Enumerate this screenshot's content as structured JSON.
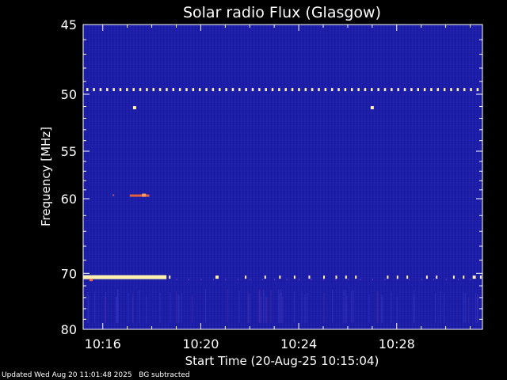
{
  "chart_data": {
    "type": "heatmap",
    "title": "Solar radio Flux (Glasgow)",
    "xlabel": "Start Time (20-Aug-25 10:15:04)",
    "ylabel": "Frequency [MHz]",
    "x_range_minutes": [
      15.2,
      31.5
    ],
    "x_ticks": [
      {
        "minute": 16,
        "label": "10:16"
      },
      {
        "minute": 20,
        "label": "10:20"
      },
      {
        "minute": 24,
        "label": "10:24"
      },
      {
        "minute": 28,
        "label": "10:28"
      }
    ],
    "y_range_mhz": [
      45,
      80
    ],
    "y_ticks": [
      45,
      50,
      55,
      60,
      70,
      80
    ],
    "background_color": "#1e1ea8",
    "hot_color": "#fff2b0",
    "features": [
      {
        "name": "interference band",
        "freq_mhz": 49.6,
        "pattern": "dotted"
      },
      {
        "name": "burst dots",
        "freq_mhz": 51.1,
        "times_min": [
          17.3,
          27.0
        ]
      },
      {
        "name": "weak emission",
        "freq_mhz": 59.6,
        "time_range_min": [
          16.4,
          17.9
        ]
      },
      {
        "name": "strong emission",
        "freq_mhz": 70.6,
        "time_range_min": [
          15.2,
          18.6
        ]
      },
      {
        "name": "intermittent emission",
        "freq_mhz": 70.6,
        "time_range_min": [
          18.6,
          31.5
        ],
        "pattern": "dashed"
      }
    ]
  },
  "footer": {
    "updated": "Updated Wed Aug 20 11:01:48 2025",
    "note": "BG subtracted"
  }
}
